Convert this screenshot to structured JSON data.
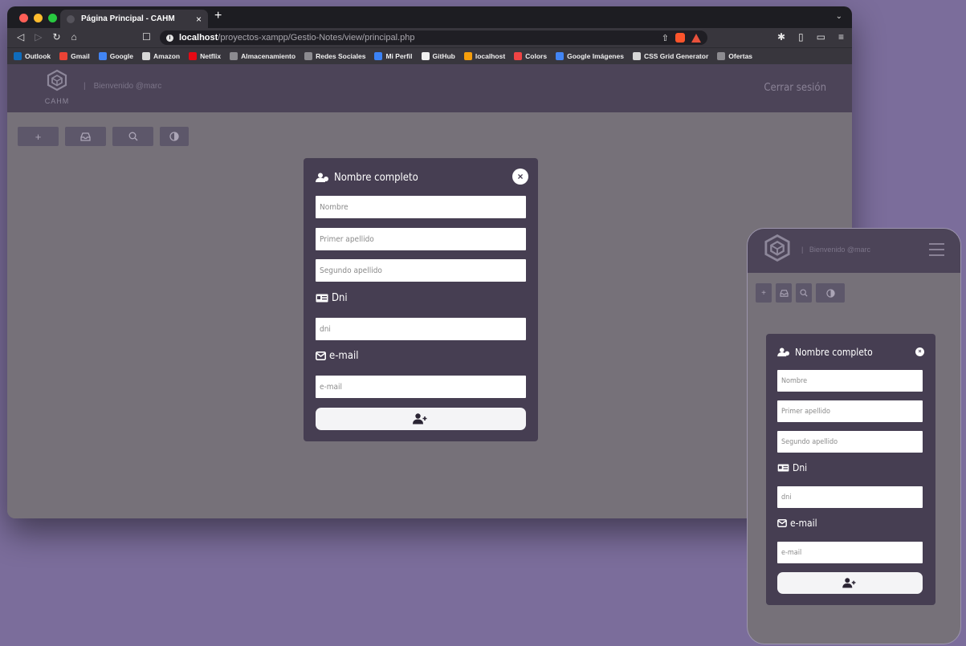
{
  "browser": {
    "tab_title": "Página Principal - CAHM",
    "url_host": "localhost",
    "url_path": "/proyectos-xampp/Gestio-Notes/view/principal.php",
    "bookmarks": [
      {
        "label": "Outlook",
        "color": "#0f6cbd"
      },
      {
        "label": "Gmail",
        "color": "#ea4335"
      },
      {
        "label": "Google",
        "color": "#4285f4"
      },
      {
        "label": "Amazon",
        "color": "#d8d8d8"
      },
      {
        "label": "Netflix",
        "color": "#e50914"
      },
      {
        "label": "Almacenamiento",
        "color": "#8c8b90"
      },
      {
        "label": "Redes Sociales",
        "color": "#8c8b90"
      },
      {
        "label": "Mi Perfil",
        "color": "#3b82f6"
      },
      {
        "label": "GitHub",
        "color": "#f0f0f0"
      },
      {
        "label": "localhost",
        "color": "#f59e0b"
      },
      {
        "label": "Colors",
        "color": "#ef4444"
      },
      {
        "label": "Google Imágenes",
        "color": "#4285f4"
      },
      {
        "label": "CSS Grid Generator",
        "color": "#d8d8d8"
      },
      {
        "label": "Ofertas",
        "color": "#8c8b90"
      }
    ]
  },
  "app": {
    "logo_text": "CAHM",
    "welcome_sep": "|",
    "welcome": "Bienvenido @marc",
    "logout": "Cerrar sesión",
    "actions": {
      "add": "+",
      "inbox": "⌂",
      "search": "⌕",
      "theme": "◐"
    }
  },
  "form": {
    "title": "Nombre completo",
    "close": "×",
    "name_placeholder": "Nombre",
    "surname1_placeholder": "Primer apellido",
    "surname2_placeholder": "Segundo apellido",
    "dni_label": "Dni",
    "dni_placeholder": "dni",
    "email_label": "e-mail",
    "email_placeholder": "e-mail"
  },
  "colors": {
    "background": "#7b6d9b",
    "header": "#4c4458",
    "modal": "#463e52",
    "overlay": "#767179"
  }
}
